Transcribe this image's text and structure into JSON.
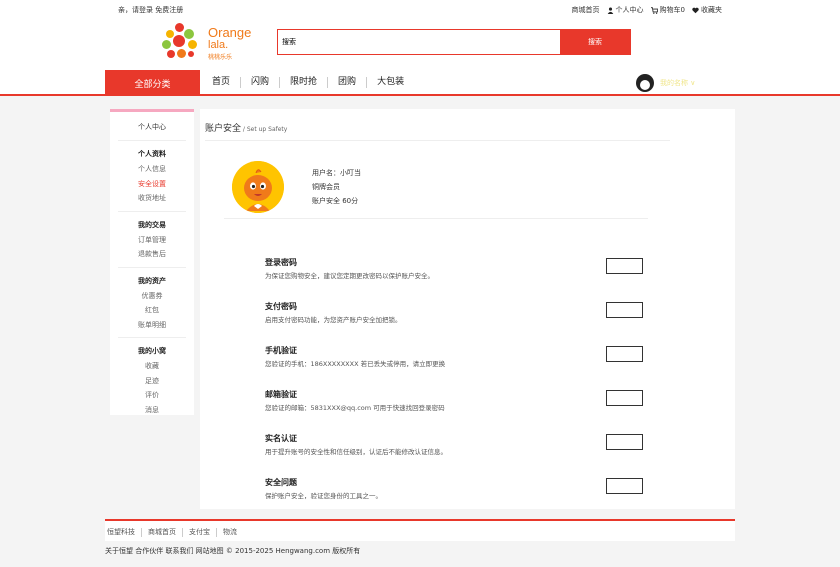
{
  "topbar": {
    "greeting": "亲，请登录 免费注册",
    "links": [
      "商城首页",
      "个人中心",
      "购物车0",
      "收藏夹"
    ]
  },
  "logo": {
    "line1": "Orange",
    "line2": "lala.",
    "line3": "桃桃乐乐"
  },
  "search": {
    "value": "搜索",
    "button": "搜索"
  },
  "nav": {
    "all_categories": "全部分类",
    "items": [
      "首页",
      "闪购",
      "限时抢",
      "团购",
      "大包装"
    ],
    "user_name": "我的名称 ∨"
  },
  "sidebar": {
    "title": "个人中心",
    "groups": [
      {
        "heading": "个人资料",
        "items": [
          "个人信息",
          "安全设置",
          "收货地址"
        ]
      },
      {
        "heading": "我的交易",
        "items": [
          "订单管理",
          "退款售后"
        ]
      },
      {
        "heading": "我的资产",
        "items": [
          "优惠券",
          "红包",
          "账单明细"
        ]
      },
      {
        "heading": "我的小窝",
        "items": [
          "收藏",
          "足迹",
          "评价",
          "消息"
        ]
      }
    ],
    "active_item": "安全设置"
  },
  "main": {
    "title": "账户安全",
    "subtitle": " / Set up Safety",
    "profile": {
      "username": "用户名：小叮当",
      "level": "铜牌会员",
      "score": "账户安全 60分"
    },
    "sections": [
      {
        "heading": "登录密码",
        "desc": "为保证您购物安全，建议您定期更改密码以保护账户安全。"
      },
      {
        "heading": "支付密码",
        "desc": "启用支付密码功能，为您资产账户安全加把锁。"
      },
      {
        "heading": "手机验证",
        "desc": "您验证的手机：186XXXXXXXX 若已丢失或停用，请立即更换"
      },
      {
        "heading": "邮箱验证",
        "desc": "您验证的邮箱：5831XXX@qq.com 可用于快速找回登录密码"
      },
      {
        "heading": "实名认证",
        "desc": "用于提升账号的安全性和信任级别，认证后不能修改认证信息。"
      },
      {
        "heading": "安全问题",
        "desc": "保护账户安全，验证您身份的工具之一。"
      }
    ]
  },
  "footer": {
    "links": [
      "恒望科技",
      "商城首页",
      "支付宝",
      "物流"
    ],
    "copyright": "关于恒望 合作伙伴 联系我们 网站地图 © 2015-2025 Hengwang.com 版权所有"
  },
  "colors": {
    "accent": "#e8382b",
    "logo": "#f07a1a",
    "active_sidebar_border": "#f6a8c0"
  }
}
